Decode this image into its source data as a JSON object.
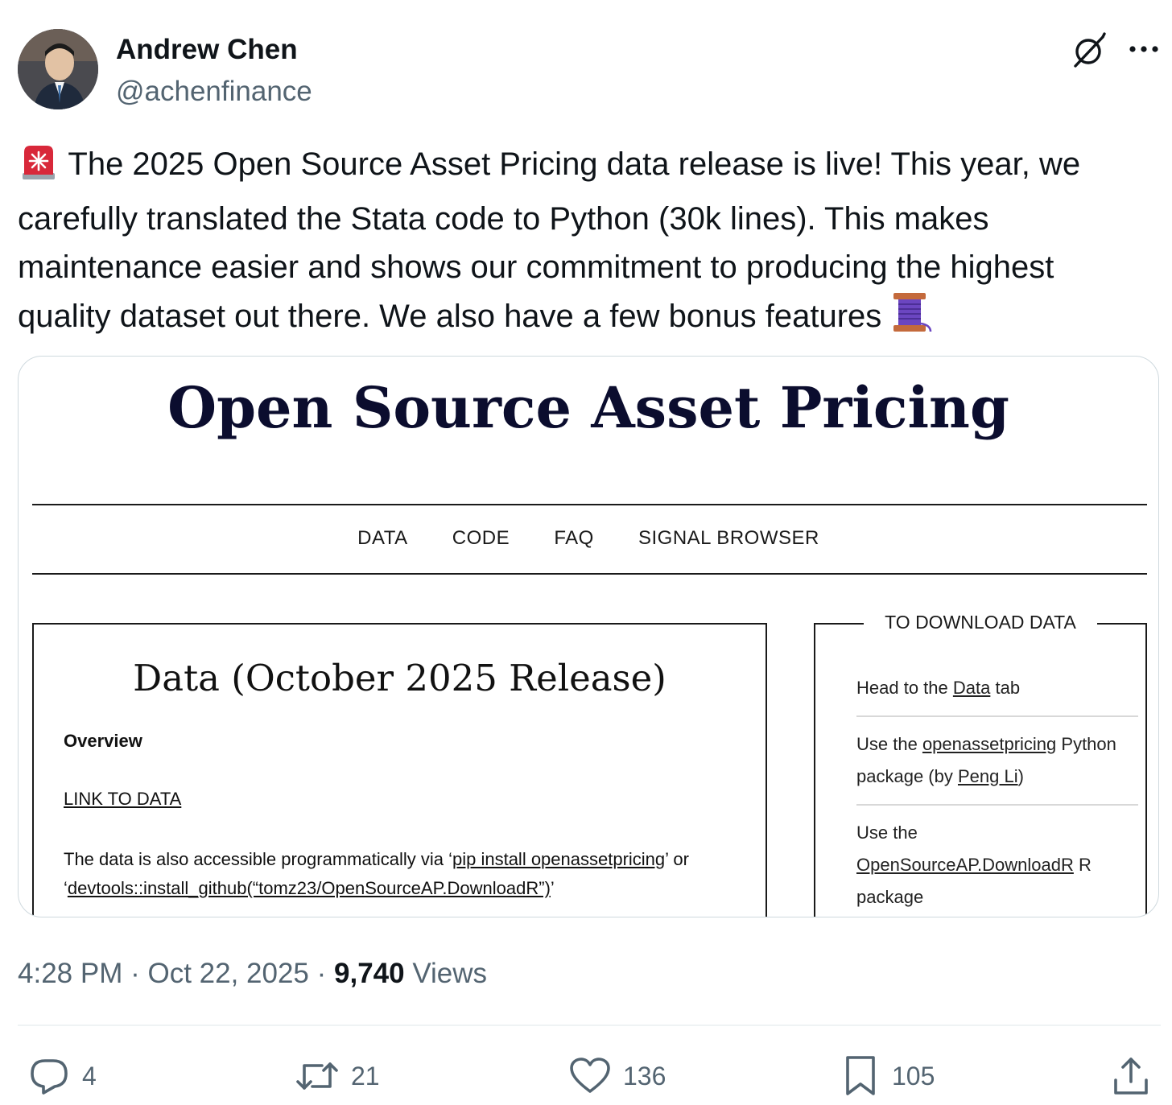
{
  "author": {
    "name": "Andrew Chen",
    "handle": "@achenfinance"
  },
  "header_icons": [
    "grok-icon",
    "more-icon"
  ],
  "tweet": {
    "lines": [
      "The 2025 Open Source Asset Pricing data release is live! This year, we",
      "carefully translated the Stata code to Python (30k lines). This makes",
      "maintenance easier and shows our commitment to producing the highest",
      "quality dataset out there. We also have a few bonus features"
    ],
    "leading_emoji": "rotating-light-icon",
    "trailing_emoji": "thread-icon"
  },
  "media": {
    "site_title": "Open Source Asset Pricing",
    "nav": [
      "DATA",
      "CODE",
      "FAQ",
      "SIGNAL BROWSER"
    ],
    "main": {
      "heading": "Data (October 2025 Release)",
      "overview": "Overview",
      "link": "LINK TO DATA",
      "access_line1_a": "The data is also accessible programmatically via ‘",
      "access_line1_link": "pip install openassetpricing",
      "access_line1_b": "’ or",
      "access_line2_a": "‘",
      "access_line2_link": "devtools::install_github(“tomz23/OpenSourceAP.DownloadR”)",
      "access_line2_b": "’"
    },
    "side": {
      "title": "TO DOWNLOAD DATA",
      "item1_a": "Head to the ",
      "item1_link": "Data",
      "item1_b": " tab",
      "item2_a": "Use the ",
      "item2_link": "openassetpricing",
      "item2_b": " Python",
      "item2_c": "package (by ",
      "item2_link2": "Peng Li",
      "item2_d": ")",
      "item3_a": "Use the",
      "item3_link": "OpenSourceAP.DownloadR",
      "item3_b": " R",
      "item3_c": "package"
    }
  },
  "meta": {
    "time": "4:28 PM",
    "sep1": " · ",
    "date": "Oct 22, 2025",
    "sep2": " · ",
    "views_count": "9,740",
    "views_label": " Views"
  },
  "actions": {
    "replies": "4",
    "reposts": "21",
    "likes": "136",
    "bookmarks": "105"
  },
  "colors": {
    "secondary_text": "#536471",
    "primary_text": "#0f1419",
    "border": "#cfd9de"
  }
}
